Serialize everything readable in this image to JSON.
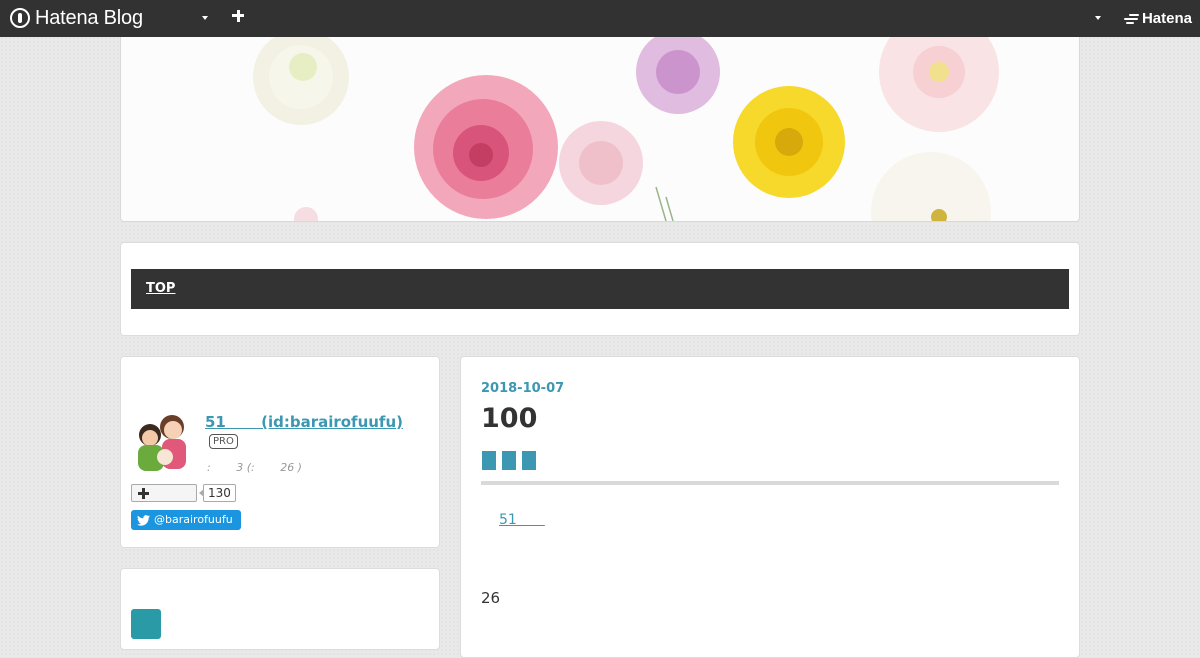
{
  "header": {
    "logo_text": "Hatena Blog",
    "brand_text": "Hatena",
    "icons": [
      "hatena-blog-logo-icon",
      "chevron-down-icon",
      "plus-icon",
      "hatena-logo-icon"
    ]
  },
  "nav": {
    "items": [
      {
        "label": "TOP"
      }
    ]
  },
  "profile": {
    "name": "51　　 (id:barairofuufu)",
    "badge": "PRO",
    "meta": ":　　 3 (:　　 26 )",
    "follow_count": "130",
    "twitter_handle": "@barairofuufu"
  },
  "article": {
    "date": "2018-10-07",
    "title": "100",
    "link_text": "51　　",
    "body_text": "26"
  },
  "colors": {
    "header_bg": "#323232",
    "accent": "#3b97b2",
    "nav_bg": "#333333",
    "twitter": "#1b95e0"
  }
}
